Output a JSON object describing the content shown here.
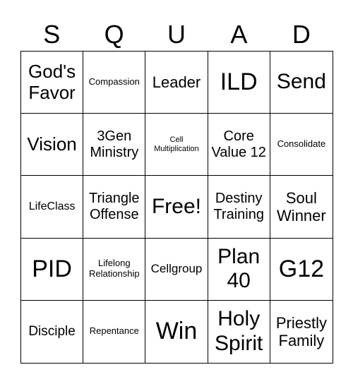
{
  "header": [
    "S",
    "Q",
    "U",
    "A",
    "D"
  ],
  "cells": [
    "God's Favor",
    "Compassion",
    "Leader",
    "ILD",
    "Send",
    "Vision",
    "3Gen Ministry",
    "Cell Multiplication",
    "Core Value 12",
    "Consolidate",
    "LifeClass",
    "Triangle Offense",
    "Free!",
    "Destiny Training",
    "Soul Winner",
    "PID",
    "Lifelong Relationship",
    "Cellgroup",
    "Plan 40",
    "G12",
    "Disciple",
    "Repentance",
    "Win",
    "Holy Spirit",
    "Priestly Family"
  ]
}
